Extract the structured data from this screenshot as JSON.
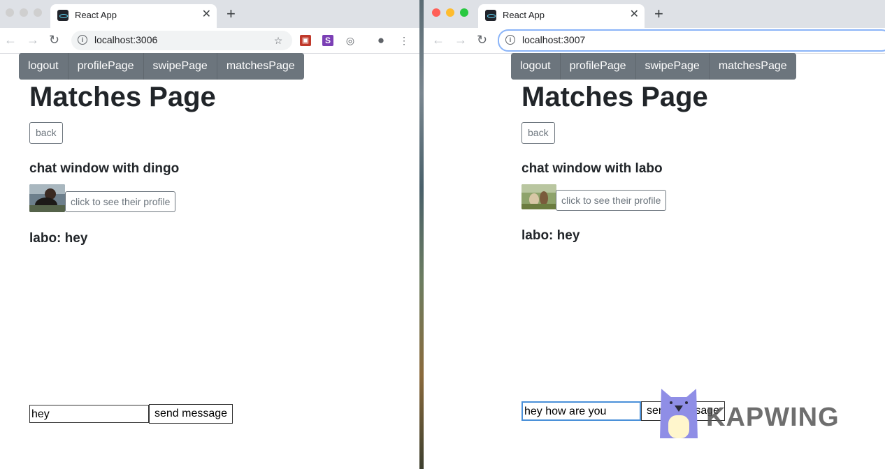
{
  "left_window": {
    "tab_title": "React App",
    "url": "localhost:3006",
    "nav_items": [
      "logout",
      "profilePage",
      "swipePage",
      "matchesPage"
    ],
    "page_title": "Matches Page",
    "back_label": "back",
    "chat_title": "chat window with dingo",
    "profile_button": "click to see their profile",
    "messages": [
      "labo: hey"
    ],
    "input_value": "hey",
    "send_label": "send message"
  },
  "right_window": {
    "tab_title": "React App",
    "url": "localhost:3007",
    "nav_items": [
      "logout",
      "profilePage",
      "swipePage",
      "matchesPage"
    ],
    "page_title": "Matches Page",
    "back_label": "back",
    "chat_title": "chat window with labo",
    "profile_button": "click to see their profile",
    "messages": [
      "labo: hey"
    ],
    "input_value": "hey how are you",
    "send_label": "send message"
  },
  "watermark": {
    "text": "KAPWING"
  },
  "colors": {
    "navbar": "#6c757d",
    "tabstrip": "#dee1e6",
    "close_dot": "#ff5f57",
    "minimize_dot": "#febc2e",
    "zoom_dot": "#28c840",
    "focus_ring": "#8ab4f8"
  }
}
